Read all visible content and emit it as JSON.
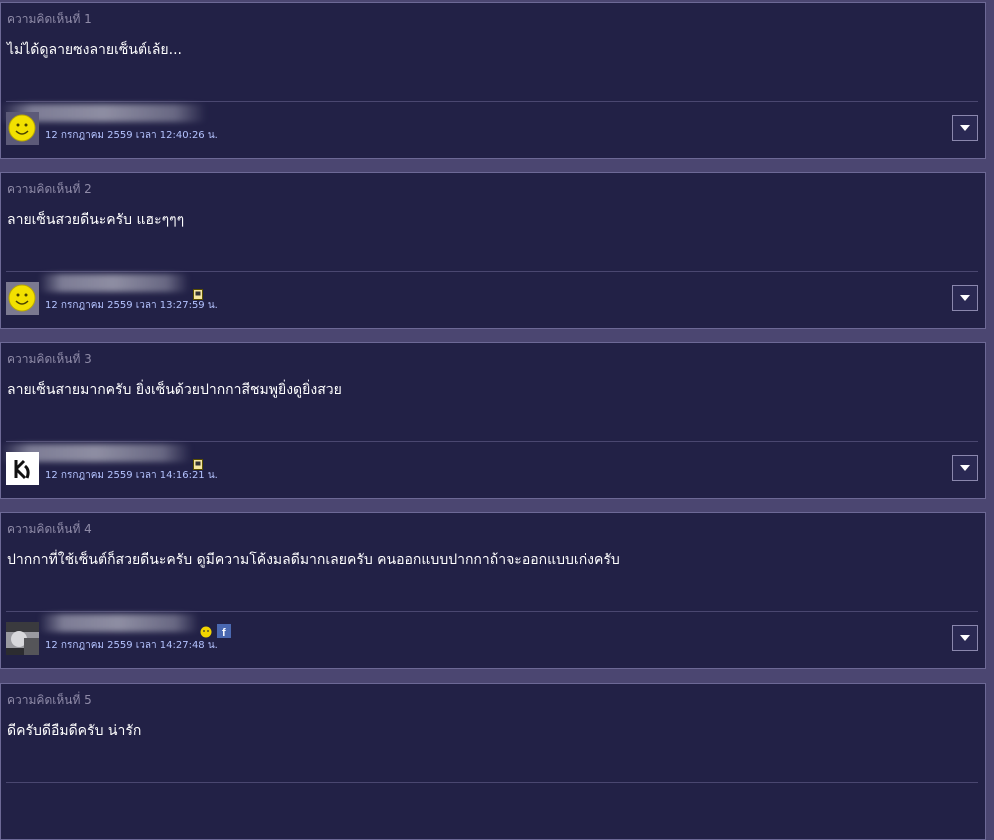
{
  "comments": [
    {
      "label": "ความคิดเห็นที่ 1",
      "text": "ไม่ได้ดูลายซงลายเซ็นต์เล้ย...",
      "date": "12 กรกฎาคม 2559 เวลา 12:40:26 น.",
      "avatar_icon": "smiley-icon",
      "badge_icon": "",
      "name_blurred": true
    },
    {
      "label": "ความคิดเห็นที่ 2",
      "text": "ลายเซ็นสวยดีนะครับ แฮะๆๆๆ",
      "date": "12 กรกฎาคม 2559 เวลา 13:27:59 น.",
      "avatar_icon": "smiley-icon",
      "badge_icon": "mobile-icon",
      "name_blurred": true
    },
    {
      "label": "ความคิดเห็นที่ 3",
      "text": "ลายเซ็นสายมากครับ ยิ่งเซ็นด้วยปากกาสีชมพูยิ่งดูยิ่งสวย",
      "date": "12 กรกฎาคม 2559 เวลา 14:16:21 น.",
      "avatar_icon": "logo-avatar-icon",
      "badge_icon": "mobile-icon",
      "name_blurred": true
    },
    {
      "label": "ความคิดเห็นที่ 4",
      "text": "ปากกาที่ใช้เซ็นต์ก็สวยดีนะครับ ดูมีความโค้งมลดีมากเลยครับ คนออกแบบปากกาถ้าจะออกแบบเก่งครับ",
      "date": "12 กรกฎาคม 2559 เวลา 14:27:48 น.",
      "avatar_icon": "photo-avatar-icon",
      "badge_icon": "facebook-icon",
      "name_blurred": true
    },
    {
      "label": "ความคิดเห็นที่ 5",
      "text": "ดีครับดีอืมดีครับ น่ารัก",
      "date": "",
      "avatar_icon": "",
      "badge_icon": "",
      "name_blurred": false
    }
  ],
  "colors": {
    "page_bg": "#4b4671",
    "card_bg": "#222146",
    "card_border": "#6d6996",
    "label_text": "#8f8ba8",
    "body_text": "#ffffff",
    "date_text": "#b4c3ff"
  }
}
